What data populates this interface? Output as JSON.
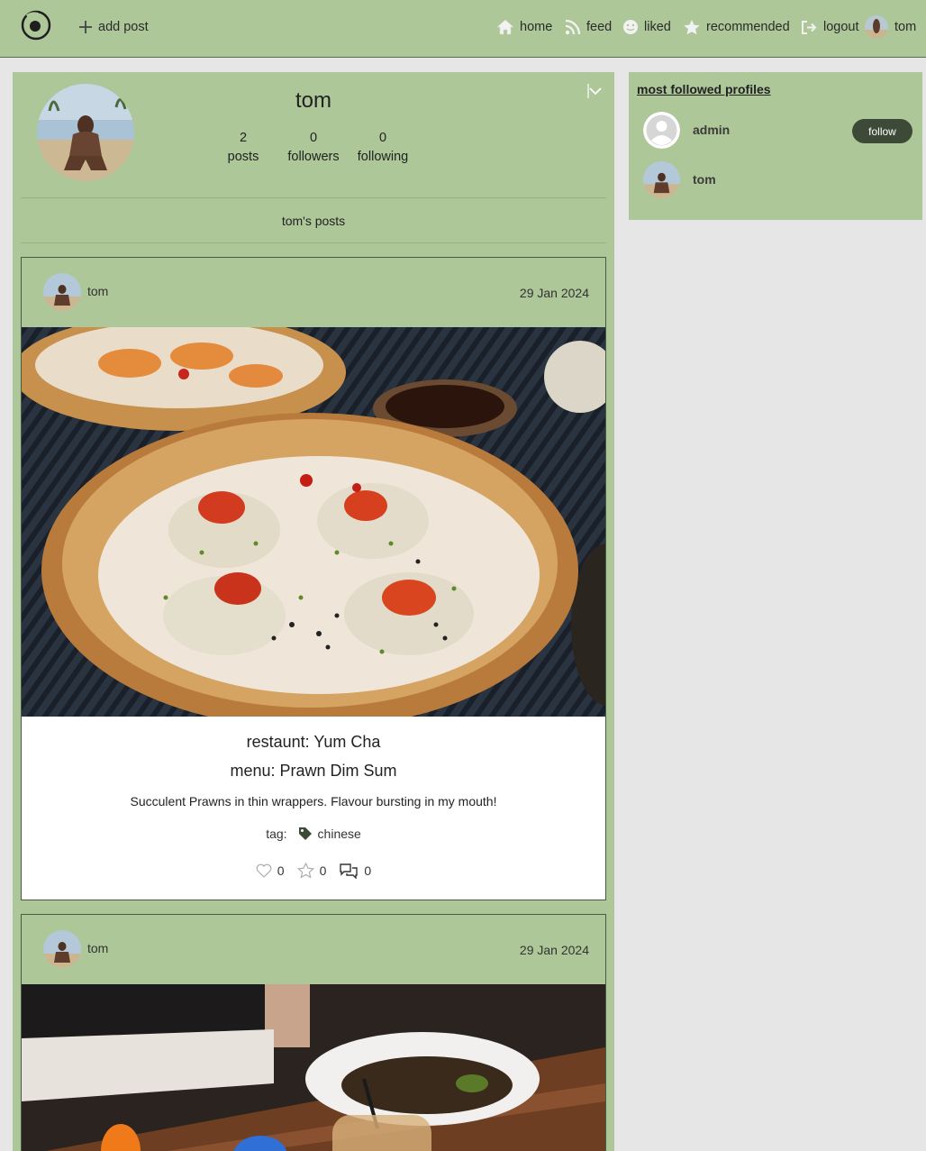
{
  "navbar": {
    "add_post": "add post",
    "home": "home",
    "feed": "feed",
    "liked": "liked",
    "recommended": "recommended",
    "logout": "logout",
    "username": "tom"
  },
  "profile": {
    "name": "tom",
    "stats": [
      {
        "value": "2",
        "label": "posts"
      },
      {
        "value": "0",
        "label": "followers"
      },
      {
        "value": "0",
        "label": "following"
      }
    ],
    "posts_heading": "tom's posts"
  },
  "posts": [
    {
      "author": "tom",
      "date": "29 Jan 2024",
      "restaurant": "restaunt: Yum Cha",
      "menu": "menu: Prawn Dim Sum",
      "description": "Succulent Prawns in thin wrappers. Flavour bursting in my mouth!",
      "tag_label": "tag:",
      "tag": "chinese",
      "likes": "0",
      "stars": "0",
      "comments": "0"
    },
    {
      "author": "tom",
      "date": "29 Jan 2024"
    }
  ],
  "sidebar": {
    "title": "most followed profiles",
    "profiles": [
      {
        "name": "admin",
        "button": "follow"
      },
      {
        "name": "tom"
      }
    ]
  },
  "colors": {
    "accent_green": "#adc798",
    "dark_button": "#3d4a37",
    "background": "#e6e6e6"
  }
}
